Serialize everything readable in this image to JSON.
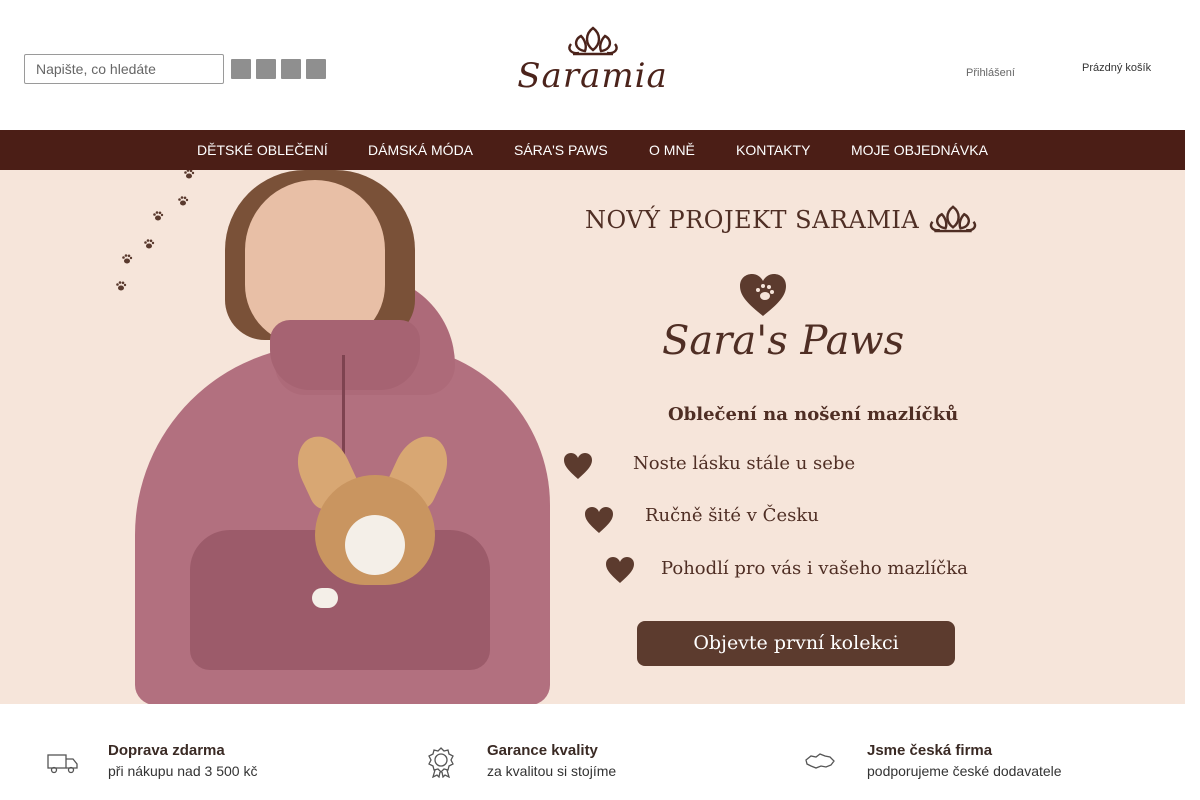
{
  "header": {
    "search": {
      "placeholder": "Napište, co hledáte",
      "button_glyph": ""
    },
    "social_icons": [
      "facebook-icon",
      "instagram-icon",
      "youtube-icon",
      "pinterest-icon"
    ],
    "social_glyph": "",
    "logo_text": "Saramia",
    "login": {
      "icon_glyph": "",
      "label": "Přihlášení"
    },
    "cart": {
      "icon_glyph": "",
      "label": "Prázdný košík"
    }
  },
  "nav": {
    "items": [
      {
        "label": "DĚTSKÉ OBLEČENÍ"
      },
      {
        "label": "DÁMSKÁ MÓDA"
      },
      {
        "label": "SÁRA'S PAWS"
      },
      {
        "label": "O MNĚ"
      },
      {
        "label": "KONTAKTY"
      },
      {
        "label": "MOJE OBJEDNÁVKA"
      }
    ]
  },
  "hero": {
    "project_title": "NOVÝ PROJEKT SARAMIA",
    "brand_script": "Sara's Paws",
    "subtitle": "Oblečení na nošení mazlíčků",
    "benefits": [
      {
        "text": "Noste lásku stále u sebe"
      },
      {
        "text": "Ručně šité v Česku"
      },
      {
        "text": "Pohodlí pro vás i vašeho mazlíčka"
      }
    ],
    "cta_label": "Objevte první kolekci"
  },
  "features": [
    {
      "icon": "truck-icon",
      "title": "Doprava zdarma",
      "subtitle": "při nákupu nad 3 500 kč"
    },
    {
      "icon": "quality-badge-icon",
      "title": "Garance kvality",
      "subtitle": "za kvalitou si stojíme"
    },
    {
      "icon": "czech-map-icon",
      "title": "Jsme česká firma",
      "subtitle": "podporujeme české dodavatele"
    }
  ],
  "colors": {
    "nav_background": "#4b1e16",
    "hero_background": "#f6e5da",
    "brand_brown": "#4f2e24",
    "cta_background": "#5c3b2e",
    "hoodie_pink": "#b2707f"
  }
}
